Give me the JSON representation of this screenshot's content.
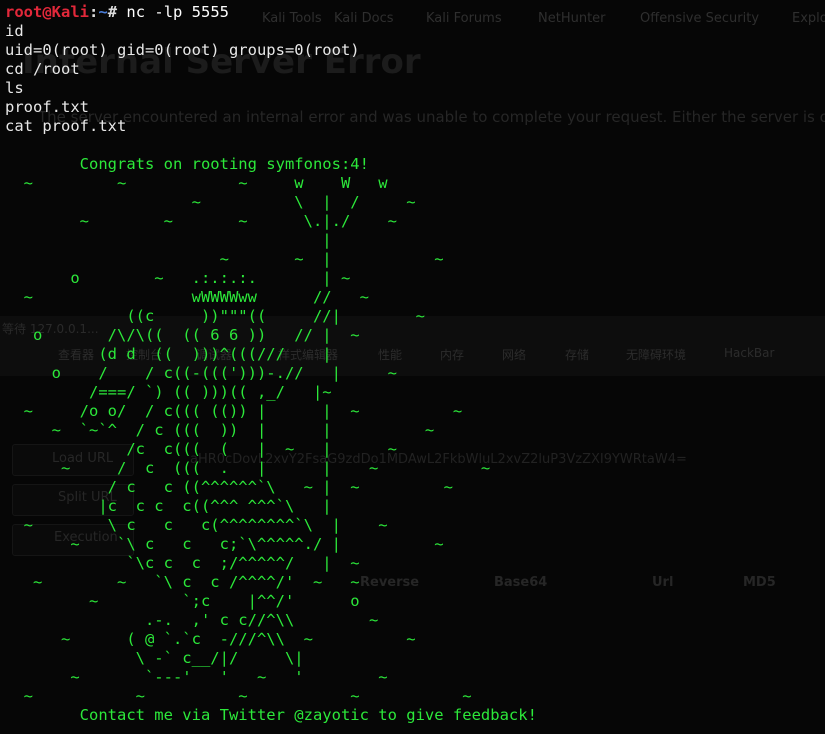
{
  "terminal": {
    "prompt_user": "root@Kali",
    "prompt_sep": ":",
    "prompt_path": "~",
    "prompt_symbol": "#",
    "command": " nc -lp 5555",
    "lines": [
      "id",
      "uid=0(root) gid=0(root) groups=0(root)",
      "cd /root",
      "ls",
      "proof.txt",
      "cat proof.txt"
    ],
    "proof_art": "\n        Congrats on rooting symfonos:4!\n  ~         ~            ~     w    W   w\n                    ~          \\  |  /     ~\n        ~        ~       ~      \\.|./    ~\n                                  |\n                       ~       ~  |           ~\n       o        ~   .:.:.:.       | ~\n  ~                 wWWWWww      //   ~\n             ((c     ))\"\"\"((     //|        ~\n   o       /\\/\\((  (( 6 6 ))   // |  ~\n          (d d  ((  )))^(((///    |\n     o    /    / c((-(((')))-.//   |     ~\n         /===/ `) (( )))(( ,_/   |~\n  ~     /o o/  / c((( (()) |      |  ~          ~\n     ~  `~`^  / c (((  ))  |      |          ~\n             /c  c(((  (   |  ~   |      ~\n      ~     /  c  (((  .   |      |    ~           ~\n           / c   c ((^^^^^^`\\   ~ |  ~         ~\n          |c  c c  c((^^^ ^^^`\\   |\n  ~        \\ c   c   c(^^^^^^^^`\\  |    ~\n       ~    `\\ c   c   c;`\\^^^^^./ |          ~\n             `\\c c  c  ;/^^^^^/   |  ~\n   ~        ~   `\\ c  c /^^^^/'  ~   ~\n         ~         `;c    |^^/'      o\n               .-.  ,' c c//^\\\\        ~\n      ~      ( @ `.`c  -///^\\\\  ~          ~\n              \\ -` c__/|/     \\|\n       ~       `---'   '   ~   '        ~\n  ~           ~          ~           ~           ~\n        Contact me via Twitter @zayotic to give feedback!"
  },
  "background_window": {
    "bookmarks": [
      "Kali Tools",
      "Kali Docs",
      "Kali Forums",
      "NetHunter",
      "Offensive Security",
      "Explo"
    ],
    "error_title": "Internal Server Error",
    "error_text": "The server encountered an internal error and was unable to complete your request. Either the server is o",
    "devtools_status": "等待 127.0.0.1...",
    "devtools_tabs": [
      "查看器",
      "控制台",
      "调试器",
      "样式编辑器",
      "性能",
      "内存",
      "网络",
      "存储",
      "无障碍环境",
      "HackBar"
    ],
    "hackbar_buttons": [
      "Load URL",
      "Split URL",
      "Execution"
    ],
    "url_text": "aHR0cDovL2xvY2FsaG9zdDo1MDAwL2FkbWluL2xvZ2luP3VzZXI9YWRtaW4=",
    "encoding_tools": [
      "Reverse",
      "Base64",
      "Url",
      "MD5"
    ]
  }
}
